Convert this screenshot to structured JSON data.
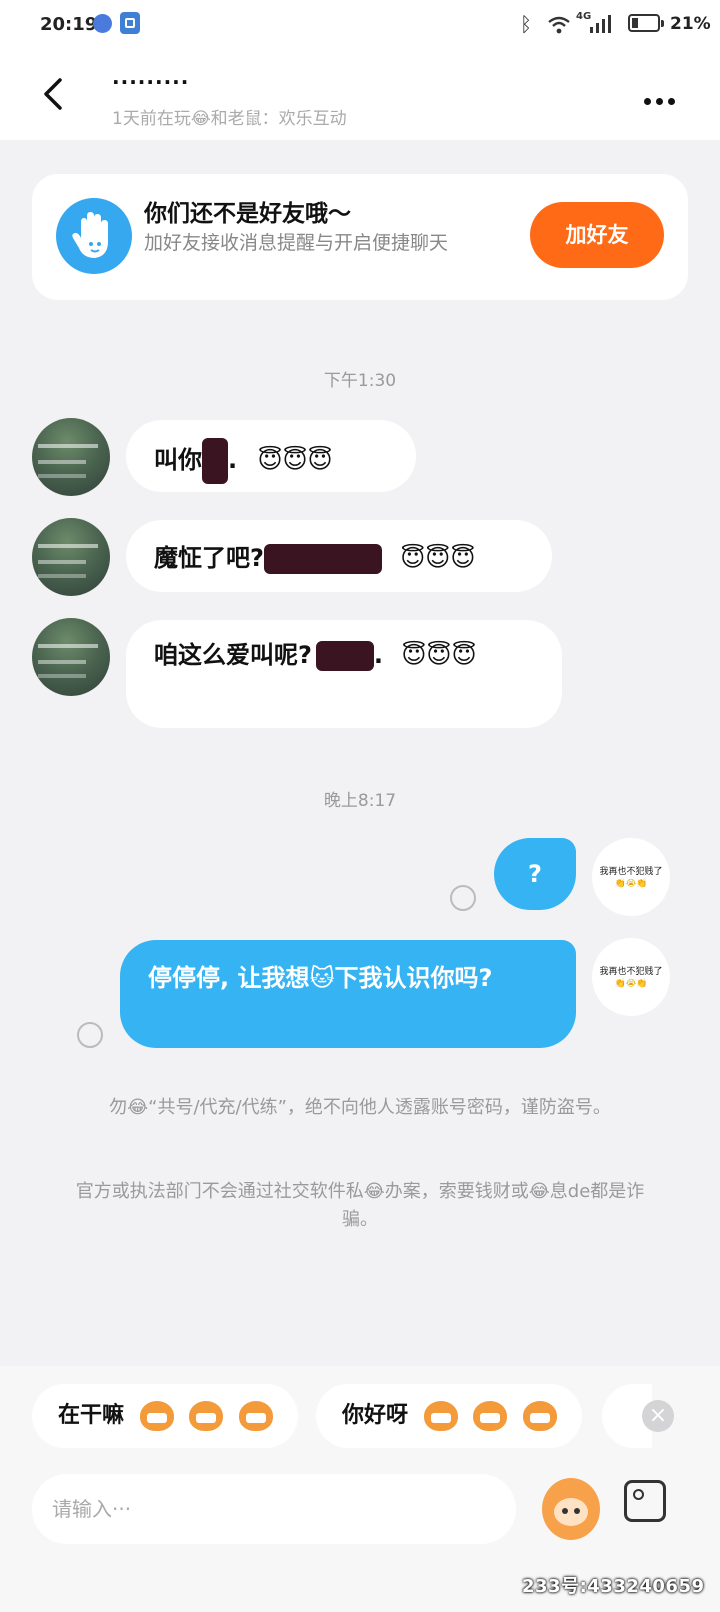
{
  "status_bar": {
    "time": "20:19",
    "network_label": "4G",
    "battery": "21%",
    "battery_level": 0.21
  },
  "header": {
    "contact_name": "·········",
    "subtitle": "1天前在玩😂和老鼠：欢乐互动"
  },
  "friend_card": {
    "title": "你们还不是好友哦～",
    "description": "加好友接收消息提醒与开启便捷聊天",
    "button_label": "加好友",
    "accent_color": "#ff6a16"
  },
  "timestamps": [
    "下午1:30",
    "晚上8:17"
  ],
  "messages_in": [
    {
      "text_before": "叫你",
      "text_after": ".",
      "emoji": "😇😇😇"
    },
    {
      "text_before": "魔怔了吧?",
      "text_after": "",
      "emoji": "😇😇😇"
    },
    {
      "text_before": "咱这么爱叫呢?",
      "text_after": ".",
      "emoji": "😇😇😇"
    }
  ],
  "messages_out": [
    {
      "text": "?"
    },
    {
      "text": "停停停, 让我想🐱下我认识你吗?"
    }
  ],
  "my_avatar": {
    "caption": "我再也不犯贱了",
    "emoji": "👏😭👏"
  },
  "notices": [
    "勿😂“共号/代充/代练”，绝不向他人透露账号密码，谨防盗号。",
    "官方或执法部门不会通过社交软件私😂办案，索要钱财或😂息de都是诈骗。"
  ],
  "quick_replies": [
    {
      "label": "在干嘛"
    },
    {
      "label": "你好呀"
    }
  ],
  "input": {
    "placeholder": "请输入···"
  },
  "watermark": "233号:433240659",
  "colors": {
    "bubble_out": "#36b3f3",
    "background": "#f2f2f4"
  }
}
